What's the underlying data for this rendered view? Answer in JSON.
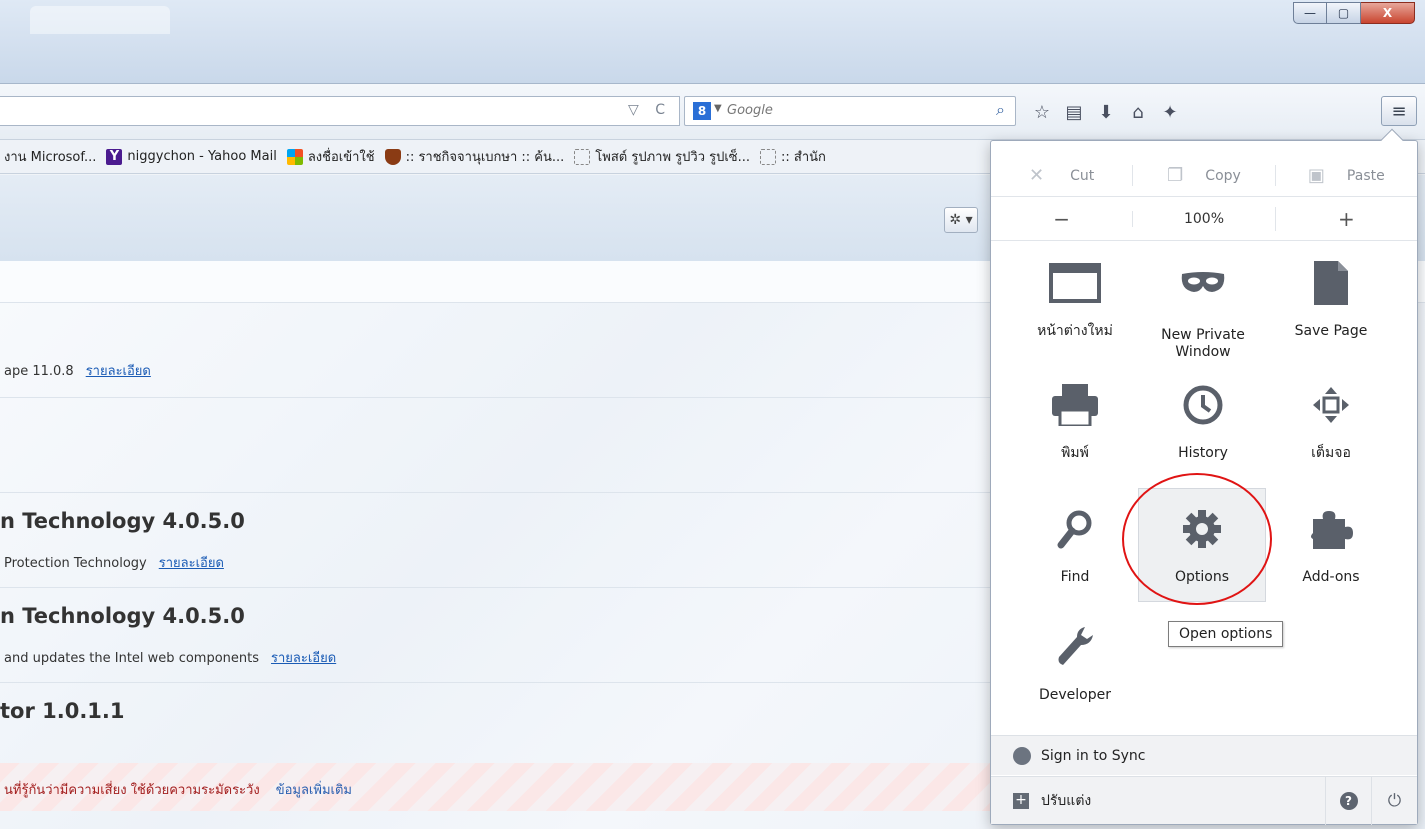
{
  "window": {
    "buttons": [
      "—",
      "▢",
      "X"
    ]
  },
  "navbar": {
    "url_icons": "▽ C",
    "search": {
      "engine_badge": "8",
      "placeholder": "Google"
    }
  },
  "bookmarks": [
    {
      "label": "งาน Microsof...",
      "icon": "none"
    },
    {
      "label": "niggychon - Yahoo Mail",
      "icon": "yahoo"
    },
    {
      "label": "ลงชื่อเข้าใช้",
      "icon": "microsoft"
    },
    {
      "label": ":: ราชกิจจานุเบกษา :: ค้น...",
      "icon": "crest"
    },
    {
      "label": "โพสต์ รูปภาพ รูปวิว รูปเซ็...",
      "icon": "dashed"
    },
    {
      "label": ":: สำนัก",
      "icon": "dashed"
    }
  ],
  "content": {
    "rows": [
      {
        "title": "",
        "desc": "ape 11.0.8",
        "link": "รายละเอียด"
      },
      {
        "title": "n Technology  4.0.5.0",
        "desc": "Protection Technology",
        "link": "รายละเอียด"
      },
      {
        "title": "n Technology  4.0.5.0",
        "desc": "and updates the Intel web components",
        "link": "รายละเอียด"
      },
      {
        "title": "tor  1.0.1.1",
        "desc": "",
        "link": ""
      }
    ],
    "warning": {
      "text": "นที่รู้กันว่ามีความเสี่ยง ใช้ด้วยความระมัดระวัง",
      "link": "ข้อมูลเพิ่มเติม"
    }
  },
  "menu": {
    "edit": {
      "cut": "Cut",
      "copy": "Copy",
      "paste": "Paste"
    },
    "zoom": {
      "minus": "−",
      "level": "100%",
      "plus": "+"
    },
    "items": {
      "new_window": "หน้าต่างใหม่",
      "private_window": "New Private Window",
      "save_page": "Save Page",
      "print": "พิมพ์",
      "history": "History",
      "fullscreen": "เต็มจอ",
      "find": "Find",
      "options": "Options",
      "addons": "Add-ons",
      "developer": "Developer"
    },
    "tooltip": "Open options",
    "sync": "Sign in to Sync",
    "customize": "ปรับแต่ง"
  }
}
